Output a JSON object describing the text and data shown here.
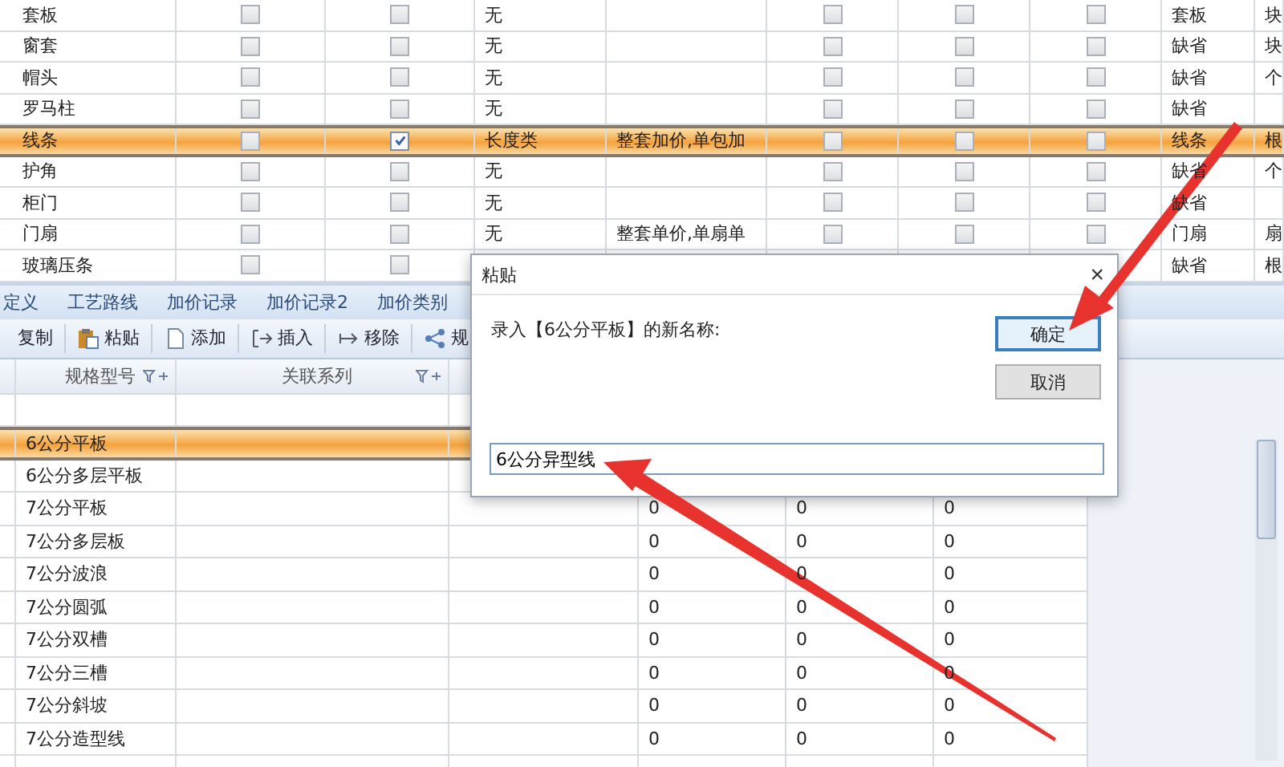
{
  "top_table": {
    "rows": [
      {
        "name": "套板",
        "check_1": false,
        "check_2": false,
        "type": "无",
        "pricing": "",
        "check_3": false,
        "check_4": false,
        "check_5": false,
        "category": "套板",
        "unit": "块",
        "selected": false
      },
      {
        "name": "窗套",
        "check_1": false,
        "check_2": false,
        "type": "无",
        "pricing": "",
        "check_3": false,
        "check_4": false,
        "check_5": false,
        "category": "缺省",
        "unit": "块",
        "selected": false
      },
      {
        "name": "帽头",
        "check_1": false,
        "check_2": false,
        "type": "无",
        "pricing": "",
        "check_3": false,
        "check_4": false,
        "check_5": false,
        "category": "缺省",
        "unit": "个",
        "selected": false
      },
      {
        "name": "罗马柱",
        "check_1": false,
        "check_2": false,
        "type": "无",
        "pricing": "",
        "check_3": false,
        "check_4": false,
        "check_5": false,
        "category": "缺省",
        "unit": "",
        "selected": false
      },
      {
        "name": "线条",
        "check_1": false,
        "check_2": true,
        "type": "长度类",
        "pricing": "整套加价,单包加",
        "check_3": false,
        "check_4": false,
        "check_5": false,
        "category": "线条",
        "unit": "根",
        "selected": true
      },
      {
        "name": "护角",
        "check_1": false,
        "check_2": false,
        "type": "无",
        "pricing": "",
        "check_3": false,
        "check_4": false,
        "check_5": false,
        "category": "缺省",
        "unit": "个",
        "selected": false
      },
      {
        "name": "柜门",
        "check_1": false,
        "check_2": false,
        "type": "无",
        "pricing": "",
        "check_3": false,
        "check_4": false,
        "check_5": false,
        "category": "缺省",
        "unit": "",
        "selected": false
      },
      {
        "name": "门扇",
        "check_1": false,
        "check_2": false,
        "type": "无",
        "pricing": "整套单价,单扇单",
        "check_3": false,
        "check_4": false,
        "check_5": false,
        "category": "门扇",
        "unit": "扇",
        "selected": false
      },
      {
        "name": "玻璃压条",
        "check_1": false,
        "check_2": false,
        "category": "缺省",
        "unit": "根",
        "selected": false
      }
    ]
  },
  "tabs": [
    "定义",
    "工艺路线",
    "加价记录",
    "加价记录2",
    "加价类别"
  ],
  "toolbar": [
    "复制",
    "粘贴",
    "添加",
    "插入",
    "移除",
    "规"
  ],
  "bottom_table": {
    "columns": [
      "规格型号",
      "关联系列"
    ],
    "rows": [
      {
        "model": "6公分平板",
        "values": [],
        "selected": true
      },
      {
        "model": "6公分多层平板",
        "values": [],
        "selected": false
      },
      {
        "model": "7公分平板",
        "values": [
          "0",
          "0",
          "0"
        ],
        "selected": false
      },
      {
        "model": "7公分多层板",
        "values": [
          "0",
          "0",
          "0"
        ],
        "selected": false
      },
      {
        "model": "7公分波浪",
        "values": [
          "0",
          "0",
          "0"
        ],
        "selected": false
      },
      {
        "model": "7公分圆弧",
        "values": [
          "0",
          "0",
          "0"
        ],
        "selected": false
      },
      {
        "model": "7公分双槽",
        "values": [
          "0",
          "0",
          "0"
        ],
        "selected": false
      },
      {
        "model": "7公分三槽",
        "values": [
          "0",
          "0",
          "0"
        ],
        "selected": false
      },
      {
        "model": "7公分斜坡",
        "values": [
          "0",
          "0",
          "0"
        ],
        "selected": false
      },
      {
        "model": "7公分造型线",
        "values": [
          "0",
          "0",
          "0"
        ],
        "selected": false
      }
    ]
  },
  "dialog": {
    "title": "粘贴",
    "close": "×",
    "prompt": "录入【6公分平板】的新名称:",
    "value": "6公分异型线",
    "buttons": [
      {
        "label": "确定",
        "default": true
      },
      {
        "label": "取消",
        "default": false
      }
    ]
  }
}
